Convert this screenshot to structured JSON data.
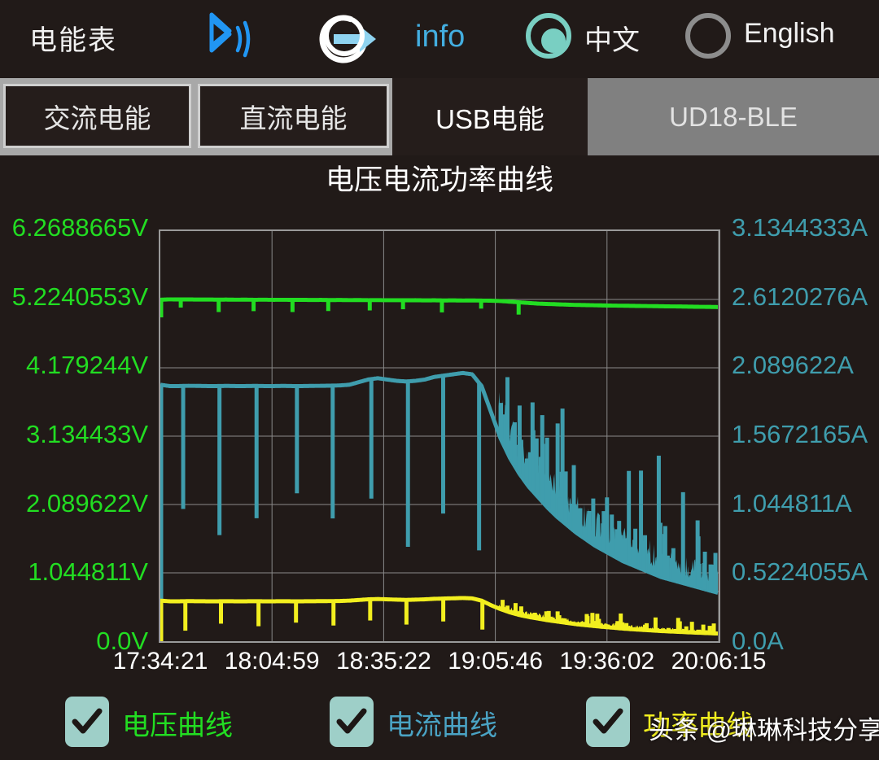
{
  "header": {
    "app_title": "电能表",
    "bluetooth_icon": "bluetooth-icon",
    "refresh_icon": "refresh-sync-icon",
    "info_label": "info",
    "language_options": [
      {
        "label": "中文",
        "selected": true
      },
      {
        "label": "English",
        "selected": false
      }
    ]
  },
  "tabs": [
    {
      "label": "交流电能",
      "state": "inactive"
    },
    {
      "label": "直流电能",
      "state": "inactive"
    },
    {
      "label": "USB电能",
      "state": "current"
    },
    {
      "label": "UD18-BLE",
      "state": "selected"
    }
  ],
  "chart_data": {
    "type": "line",
    "title": "电压电流功率曲线",
    "xlabel": "",
    "ylabel": "",
    "grid": true,
    "legend_position": "bottom",
    "x_ticks": [
      "17:34:21",
      "18:04:59",
      "18:35:22",
      "19:05:46",
      "19:36:02",
      "20:06:15"
    ],
    "y_left_ticks": [
      "0.0V",
      "1.044811V",
      "2.089622V",
      "3.134433V",
      "4.179244V",
      "5.2240553V",
      "6.2688665V"
    ],
    "y_right_ticks": [
      "0.0A",
      "0.5224055A",
      "1.044811A",
      "1.5672165A",
      "2.089622A",
      "2.6120276A",
      "3.1344333A"
    ],
    "ylim_left": [
      0.0,
      6.2688665
    ],
    "ylim_right": [
      0.0,
      3.1344333
    ],
    "y_left_unit": "V",
    "y_right_unit": "A",
    "series": [
      {
        "name": "电压曲线",
        "color": "#22dd22",
        "axis": "left",
        "unit": "V",
        "values": [
          5.22,
          5.225,
          5.223,
          5.224,
          5.222,
          5.223,
          5.221,
          5.222,
          5.22,
          5.221,
          5.219,
          5.22,
          5.218,
          5.219,
          5.217,
          5.218,
          5.216,
          5.217,
          5.215,
          5.216,
          5.214,
          5.215,
          5.213,
          5.214,
          5.212,
          5.213,
          5.211,
          5.212,
          5.21,
          5.211,
          5.209,
          5.21,
          5.208,
          5.209,
          5.207,
          5.205,
          5.2,
          5.19,
          5.18,
          5.17,
          5.16,
          5.155,
          5.15,
          5.145,
          5.14,
          5.138,
          5.135,
          5.132,
          5.13,
          5.128,
          5.126,
          5.124,
          5.122,
          5.12,
          5.118,
          5.116,
          5.114,
          5.112,
          5.11,
          5.108
        ]
      },
      {
        "name": "电流曲线",
        "color": "#3f9dad",
        "axis": "right",
        "unit": "A",
        "values": [
          1.96,
          1.95,
          1.95,
          1.952,
          1.951,
          1.95,
          1.95,
          1.951,
          1.95,
          1.95,
          1.951,
          1.95,
          1.95,
          1.951,
          1.95,
          1.95,
          1.951,
          1.952,
          1.953,
          1.955,
          1.96,
          1.98,
          2.0,
          2.01,
          2.0,
          1.99,
          1.985,
          1.99,
          2.0,
          2.02,
          2.03,
          2.04,
          2.05,
          2.04,
          1.95,
          1.75,
          1.55,
          1.4,
          1.28,
          1.18,
          1.1,
          1.02,
          0.95,
          0.89,
          0.83,
          0.78,
          0.73,
          0.69,
          0.65,
          0.61,
          0.58,
          0.55,
          0.52,
          0.49,
          0.47,
          0.45,
          0.43,
          0.41,
          0.39,
          0.37
        ]
      },
      {
        "name": "功率曲线",
        "color": "#f2ef1f",
        "axis": "left",
        "unit": "W",
        "values": [
          0.62,
          0.61,
          0.61,
          0.612,
          0.611,
          0.61,
          0.61,
          0.611,
          0.61,
          0.61,
          0.611,
          0.61,
          0.61,
          0.611,
          0.61,
          0.61,
          0.611,
          0.612,
          0.613,
          0.615,
          0.62,
          0.63,
          0.64,
          0.645,
          0.64,
          0.635,
          0.632,
          0.635,
          0.64,
          0.648,
          0.652,
          0.656,
          0.66,
          0.655,
          0.62,
          0.55,
          0.49,
          0.44,
          0.4,
          0.37,
          0.345,
          0.32,
          0.3,
          0.28,
          0.26,
          0.245,
          0.23,
          0.217,
          0.205,
          0.192,
          0.182,
          0.173,
          0.164,
          0.155,
          0.148,
          0.142,
          0.135,
          0.129,
          0.123,
          0.117
        ]
      }
    ]
  },
  "legend": [
    {
      "label": "电压曲线",
      "checked": true,
      "color": "#22dd22"
    },
    {
      "label": "电流曲线",
      "checked": true,
      "color": "#4aa3c4"
    },
    {
      "label": "功率曲线",
      "checked": true,
      "color": "#f2ef1f"
    }
  ],
  "watermark": "头条 @琳琳科技分享"
}
